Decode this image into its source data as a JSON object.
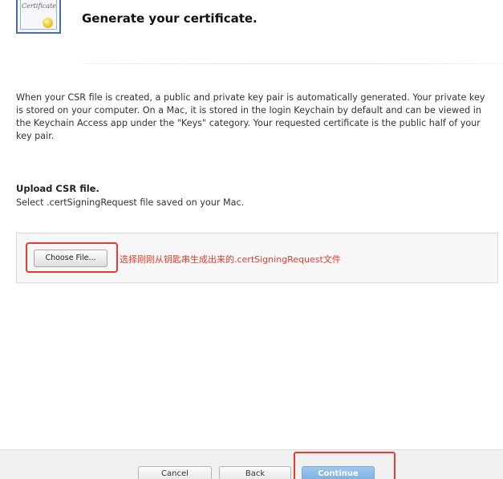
{
  "header": {
    "title": "Generate your certificate.",
    "icon": "certificate-icon",
    "icon_script": "Certificate"
  },
  "intro": {
    "text": "When your CSR file is created, a public and private key pair is automatically generated. Your private key is stored on your computer. On a Mac, it is stored in the login Keychain by default and can be viewed in the Keychain Access app under the \"Keys\" category. Your requested certificate is the public half of your key pair."
  },
  "upload": {
    "title": "Upload CSR file.",
    "subtitle": "Select .certSigningRequest file saved on your Mac.",
    "choose_button": "Choose File...",
    "annotation": "选择刚刚从钥匙串生成出来的.certSigningRequest文件"
  },
  "footer": {
    "cancel_label": "Cancel",
    "back_label": "Back",
    "continue_label": "Continue"
  },
  "colors": {
    "highlight": "#e53c2e",
    "continue_button": "#8bbbe8",
    "footer_bg": "#f0f0f0"
  }
}
